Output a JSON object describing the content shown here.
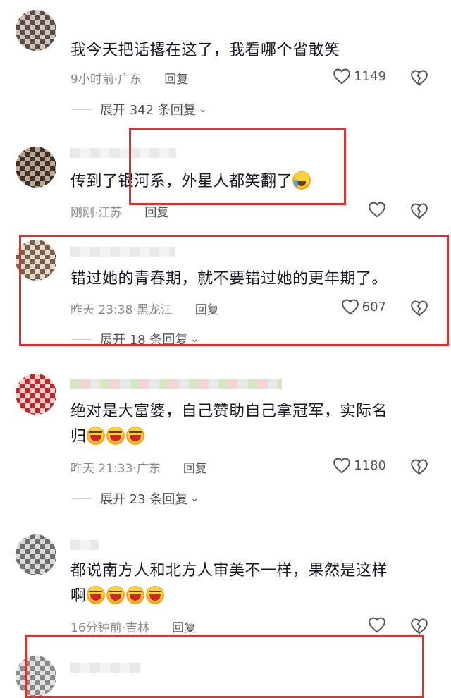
{
  "comments": [
    {
      "text": "我今天把话撂在这了，我看哪个省敢笑",
      "time": "9小时前",
      "location": "广东",
      "reply_label": "回复",
      "likes": "1149",
      "expand": "展开 342 条回复"
    },
    {
      "text": "传到了银河系，外星人都笑翻了",
      "emoji": "cry-laugh",
      "time": "刚刚",
      "location": "江苏",
      "reply_label": "回复",
      "likes": ""
    },
    {
      "text": "错过她的青春期，就不要错过她的更年期了。",
      "time": "昨天 23:38",
      "location": "黑龙江",
      "reply_label": "回复",
      "likes": "607",
      "expand": "展开 18 条回复"
    },
    {
      "text_line1": "绝对是大富婆，自己赞助自己拿冠军，实际名",
      "text_line2": "归",
      "emoji_count": 3,
      "time": "昨天 21:33",
      "location": "广东",
      "reply_label": "回复",
      "likes": "1180",
      "expand": "展开 23 条回复"
    },
    {
      "text_line1": "都说南方人和北方人审美不一样，果然是这样",
      "text_line2": "啊",
      "emoji_count": 4,
      "time": "16分钟前",
      "location": "吉林",
      "reply_label": "回复",
      "likes": ""
    }
  ],
  "separator": "·",
  "accent_red": "#e0302b",
  "icons": [
    "heart-outline-icon",
    "broken-heart-icon",
    "chevron-down-icon"
  ]
}
